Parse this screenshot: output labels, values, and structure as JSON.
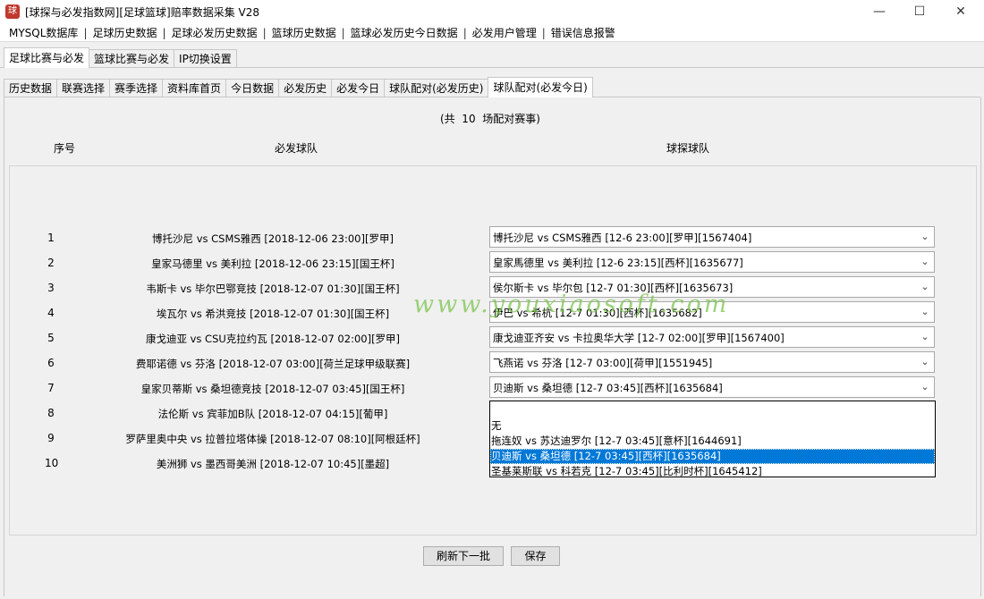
{
  "window": {
    "title": "[球探与必发指数网][足球篮球]赔率数据采集 V28",
    "app_icon": "app-logo-icon",
    "controls": {
      "minimize": "—",
      "maximize": "☐",
      "close": "✕"
    }
  },
  "menu": {
    "items": [
      "MYSQL数据库",
      "足球历史数据",
      "足球必发历史数据",
      "篮球历史数据",
      "篮球必发历史今日数据",
      "必发用户管理",
      "错误信息报警"
    ],
    "separator": "|"
  },
  "tabs_main": [
    {
      "label": "足球比赛与必发",
      "active": true
    },
    {
      "label": "篮球比赛与必发",
      "active": false
    },
    {
      "label": "IP切换设置",
      "active": false
    }
  ],
  "tabs_sub": [
    {
      "label": "历史数据",
      "active": false
    },
    {
      "label": "联赛选择",
      "active": false
    },
    {
      "label": "赛季选择",
      "active": false
    },
    {
      "label": "资料库首页",
      "active": false
    },
    {
      "label": "今日数据",
      "active": false
    },
    {
      "label": "必发历史",
      "active": false
    },
    {
      "label": "必发今日",
      "active": false
    },
    {
      "label": "球队配对(必发历史)",
      "active": false
    },
    {
      "label": "球队配对(必发今日)",
      "active": true
    }
  ],
  "summary": "(共  10  场配对赛事)",
  "headers": {
    "index": "序号",
    "bifa": "必发球队",
    "qiutan": "球探球队"
  },
  "rows": [
    {
      "index": "1",
      "match": "博托沙尼 vs CSMS雅西 [2018-12-06 23:00][罗甲]",
      "selected": "博托沙尼 vs CSMS雅西 [12-6 23:00][罗甲][1567404]"
    },
    {
      "index": "2",
      "match": "皇家马德里 vs 美利拉 [2018-12-06 23:15][国王杯]",
      "selected": "皇家馬德里 vs 美利拉 [12-6 23:15][西杯][1635677]"
    },
    {
      "index": "3",
      "match": "韦斯卡 vs 毕尔巴鄂竞技 [2018-12-07 01:30][国王杯]",
      "selected": "侯尔斯卡 vs 毕尔包 [12-7 01:30][西杯][1635673]"
    },
    {
      "index": "4",
      "match": "埃瓦尔 vs 希洪竞技 [2018-12-07 01:30][国王杯]",
      "selected": "伊巴 vs 希杭 [12-7 01:30][西杯][1635682]"
    },
    {
      "index": "5",
      "match": "康戈迪亚 vs CSU克拉约瓦 [2018-12-07 02:00][罗甲]",
      "selected": "康戈迪亚齐安 vs 卡拉奥华大学 [12-7 02:00][罗甲][1567400]"
    },
    {
      "index": "6",
      "match": "费耶诺德 vs 芬洛 [2018-12-07 03:00][荷兰足球甲级联赛]",
      "selected": "飞燕诺 vs 芬洛 [12-7 03:00][荷甲][1551945]"
    },
    {
      "index": "7",
      "match": "皇家贝蒂斯 vs 桑坦德竞技 [2018-12-07 03:45][国王杯]",
      "selected": "贝迪斯 vs 桑坦德 [12-7 03:45][西杯][1635684]"
    },
    {
      "index": "8",
      "match": "法伦斯 vs 宾菲加B队 [2018-12-07 04:15][葡甲]",
      "selected": ""
    },
    {
      "index": "9",
      "match": "罗萨里奥中央 vs 拉普拉塔体操 [2018-12-07 08:10][阿根廷杯]",
      "selected": ""
    },
    {
      "index": "10",
      "match": "美洲狮 vs 墨西哥美洲 [2018-12-07 10:45][墨超]",
      "selected": ""
    }
  ],
  "dropdown": {
    "options": [
      {
        "label": "无",
        "selected": false
      },
      {
        "label": "拖连奴 vs 苏达迪罗尔 [12-7 03:45][意杯][1644691]",
        "selected": false
      },
      {
        "label": "贝迪斯 vs 桑坦德 [12-7 03:45][西杯][1635684]",
        "selected": true
      },
      {
        "label": "圣基莱斯联 vs 科若克 [12-7 03:45][比利时杯][1645412]",
        "selected": false
      }
    ]
  },
  "watermark": "www.youxiaosoft.com",
  "buttons": {
    "refresh": "刷新下一批",
    "save": "保存"
  }
}
